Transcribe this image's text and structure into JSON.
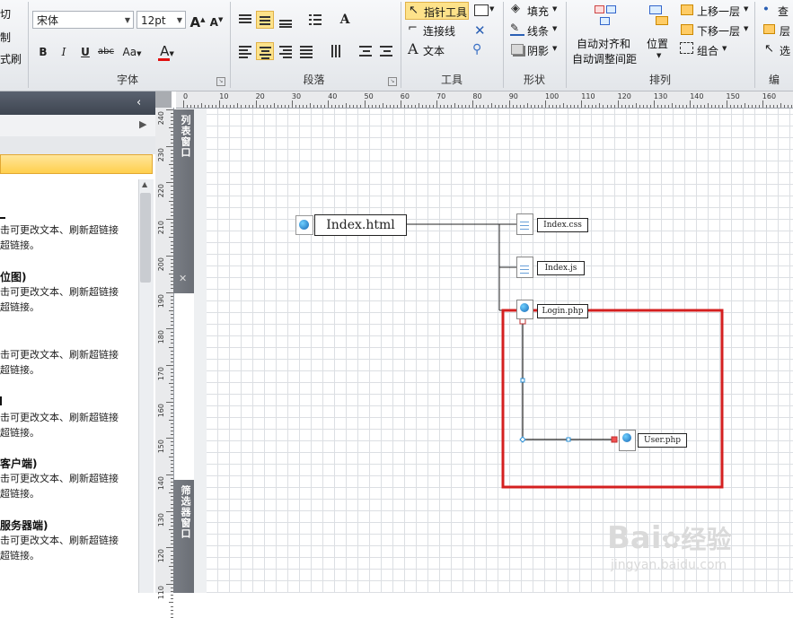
{
  "ribbon": {
    "clipboard_partial": [
      "切",
      "制",
      "式刷"
    ],
    "font": {
      "family": "宋体",
      "size": "12pt",
      "grow_label": "A",
      "shrink_label": "A",
      "bold": "B",
      "italic": "I",
      "underline": "U",
      "strike": "abc",
      "case": "Aa",
      "color": "A",
      "group_label": "字体"
    },
    "paragraph": {
      "group_label": "段落",
      "text_style_label": "A"
    },
    "tools": {
      "pointer_label": "指针工具",
      "connector_label": "连接线",
      "text_label": "文本",
      "group_label": "工具"
    },
    "shape": {
      "fill_label": "填充",
      "line_label": "线条",
      "shadow_label": "阴影",
      "group_label": "形状"
    },
    "arrange": {
      "auto_align_label": "自动对齐和",
      "auto_space_label": "自动调整间距",
      "position_label": "位置",
      "bring_forward_label": "上移一层",
      "send_backward_label": "下移一层",
      "group_label": "组合",
      "section_label": "排列"
    },
    "edit_partial": {
      "find_label": "查",
      "layer_label": "层",
      "select_label": "选",
      "section_label": "编"
    }
  },
  "left_panel": {
    "items": [
      {
        "title": "",
        "line1": "击可更改文本、刷新超链接",
        "line2": "超链接。"
      },
      {
        "title": "位图)",
        "line1": "击可更改文本、刷新超链接",
        "line2": "超链接。"
      },
      {
        "title": "",
        "line1": "击可更改文本、刷新超链接",
        "line2": "超链接。"
      },
      {
        "title": "",
        "line1": "击可更改文本、刷新超链接",
        "line2": "超链接。"
      },
      {
        "title": "客户端)",
        "line1": "击可更改文本、刷新超链接",
        "line2": "超链接。"
      },
      {
        "title": "服务器端)",
        "line1": "击可更改文本、刷新超链接",
        "line2": "超链接。"
      }
    ]
  },
  "side_tabs": {
    "list_window": "列表窗口",
    "filter_window": "筛选器窗口",
    "close_glyph": "✕"
  },
  "rulers": {
    "horizontal": [
      "0",
      "10",
      "20",
      "30",
      "40",
      "50",
      "60",
      "70",
      "80",
      "90",
      "100",
      "110",
      "120",
      "130",
      "140",
      "150",
      "160"
    ],
    "vertical": [
      "240",
      "230",
      "220",
      "210",
      "200",
      "190",
      "180",
      "170",
      "160",
      "150",
      "140",
      "130",
      "120",
      "110"
    ]
  },
  "diagram": {
    "root": "Index.html",
    "children": [
      "Index.css",
      "Index.js",
      "Login.php"
    ],
    "new_node": "User.php"
  },
  "colors": {
    "highlight_box": "#d42020",
    "pointer_highlight": "#fde28a",
    "connector": "#222222",
    "handle": "#2a8fd6"
  },
  "watermark": {
    "brand": "Bai",
    "brand2": "经验",
    "url": "jingyan.baidu.com"
  }
}
